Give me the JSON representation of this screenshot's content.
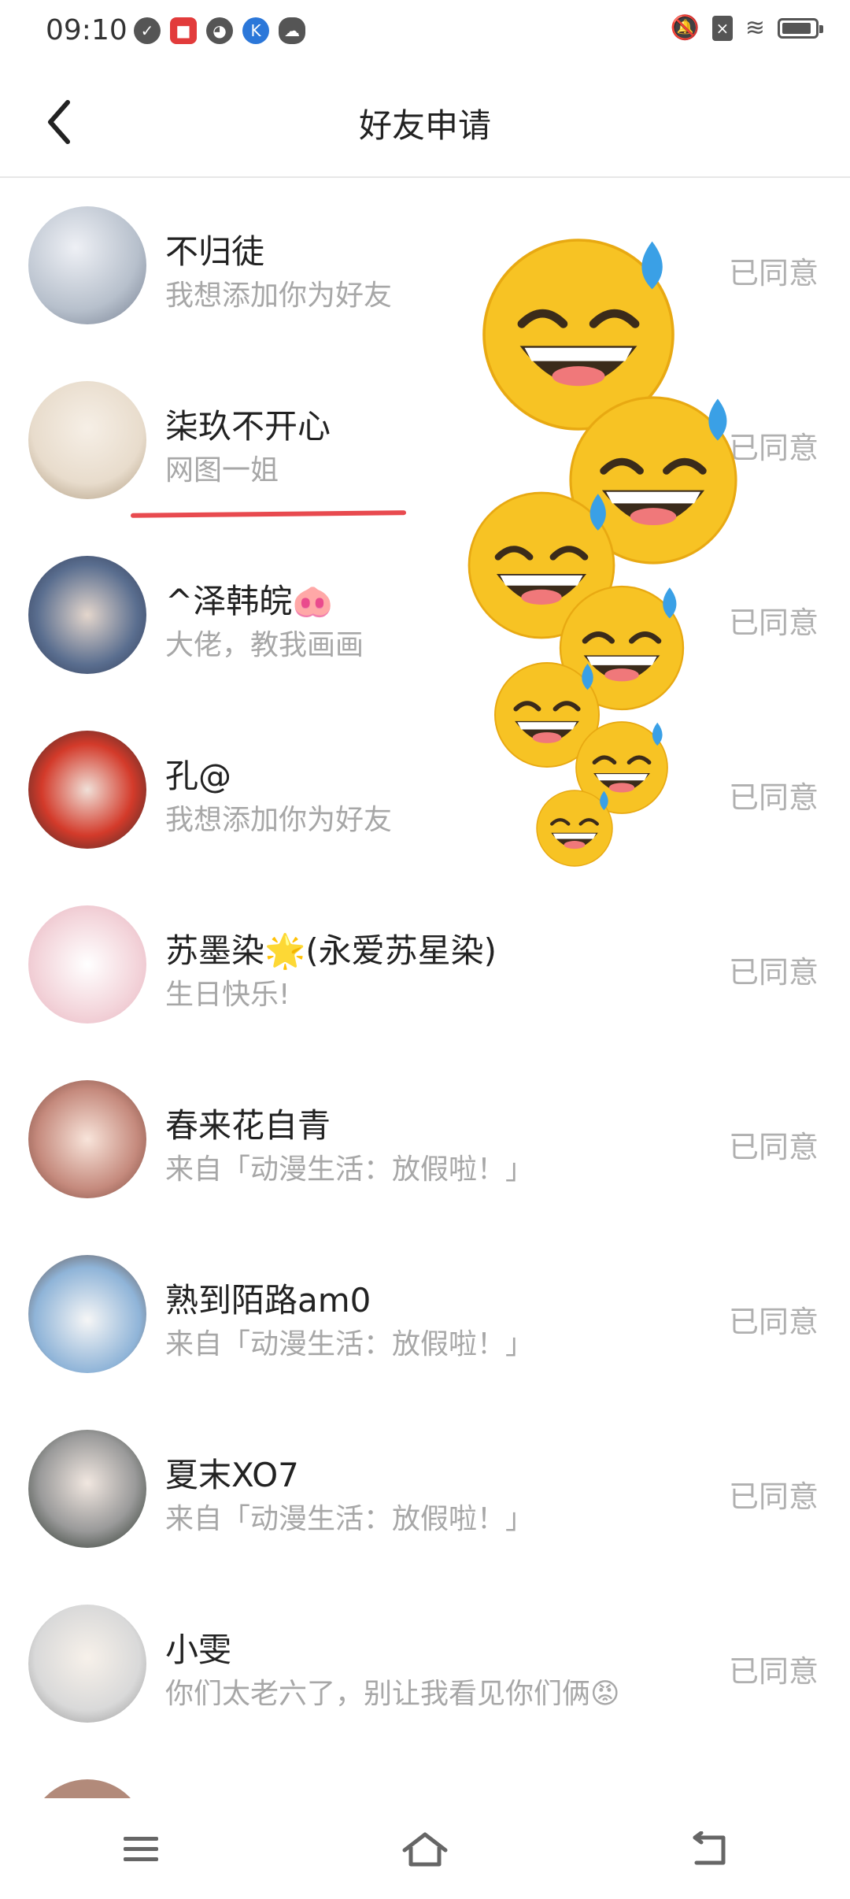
{
  "status_bar": {
    "time": "09:10",
    "icons": [
      "clock-icon",
      "app-icon",
      "cat-icon",
      "k-icon",
      "cloud-icon"
    ],
    "right_icons": [
      "mute-icon",
      "sim-icon",
      "wifi-icon",
      "battery-icon"
    ]
  },
  "header": {
    "title": "好友申请"
  },
  "requests": [
    {
      "nickname": "不归徒",
      "message": "我想添加你为好友",
      "status": "已同意",
      "avatar_color": "#b7c0cc"
    },
    {
      "nickname": "柒玖不开心",
      "message": "网图一姐",
      "status": "已同意",
      "avatar_color": "#e8dccc"
    },
    {
      "nickname": "^泽韩皖🐽",
      "message": "大佬，教我画画",
      "status": "已同意",
      "avatar_color": "#5a6e8f"
    },
    {
      "nickname": "孔@",
      "message": "我想添加你为好友",
      "status": "已同意",
      "avatar_color": "#d33a2a"
    },
    {
      "nickname": "苏墨染🌟(永爱苏星染)",
      "message": "生日快乐!",
      "status": "已同意",
      "avatar_color": "#f3d4da"
    },
    {
      "nickname": "春来花自青",
      "message": "来自「动漫生活：放假啦！」",
      "status": "已同意",
      "avatar_color": "#c58a7d"
    },
    {
      "nickname": "熟到陌路am0",
      "message": "来自「动漫生活：放假啦！」",
      "status": "已同意",
      "avatar_color": "#8fb4d8"
    },
    {
      "nickname": "夏末XO7",
      "message": "来自「动漫生活：放假啦！」",
      "status": "已同意",
      "avatar_color": "#9a9a9a"
    },
    {
      "nickname": "小雯",
      "message": "你们太老六了，别让我看见你们俩😡",
      "status": "已同意",
      "avatar_color": "#d9d9d9"
    }
  ],
  "navbar": {
    "items": [
      "menu-icon",
      "home-icon",
      "back-icon"
    ]
  },
  "colors": {
    "accent_underline": "#e84a4f",
    "status_gray": "#b0b0b0",
    "message_gray": "#a7a7a7"
  }
}
